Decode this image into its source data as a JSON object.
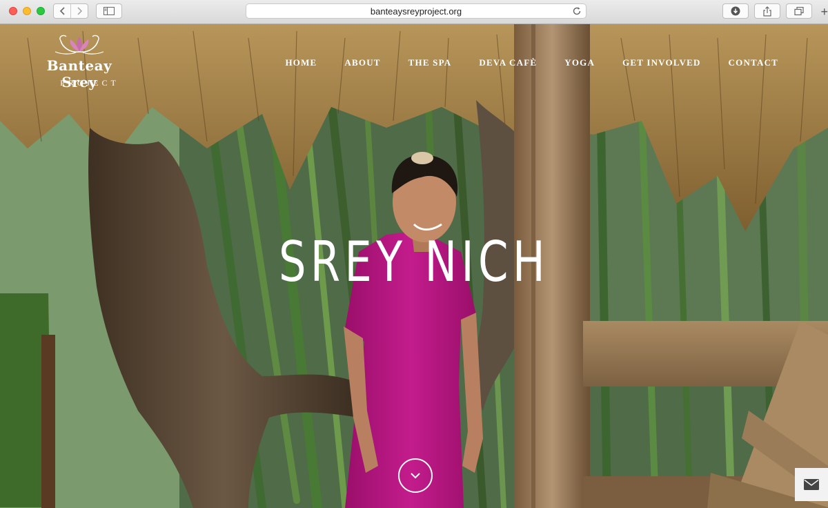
{
  "browser": {
    "url": "banteaysreyproject.org",
    "new_tab_label": "+"
  },
  "header": {
    "logo": {
      "name": "Banteay Srey",
      "sub": "PROJECT"
    },
    "nav": [
      {
        "label": "HOME"
      },
      {
        "label": "ABOUT"
      },
      {
        "label": "THE SPA"
      },
      {
        "label": "DEVA CAFÈ"
      },
      {
        "label": "YOGA"
      },
      {
        "label": "GET INVOLVED"
      },
      {
        "label": "CONTACT"
      }
    ]
  },
  "hero": {
    "title": "SREY NICH"
  },
  "colors": {
    "dress": "#b2147e",
    "thatch": "#a07f45",
    "bamboo": "#4f7a3c",
    "wood": "#9b7a54"
  }
}
